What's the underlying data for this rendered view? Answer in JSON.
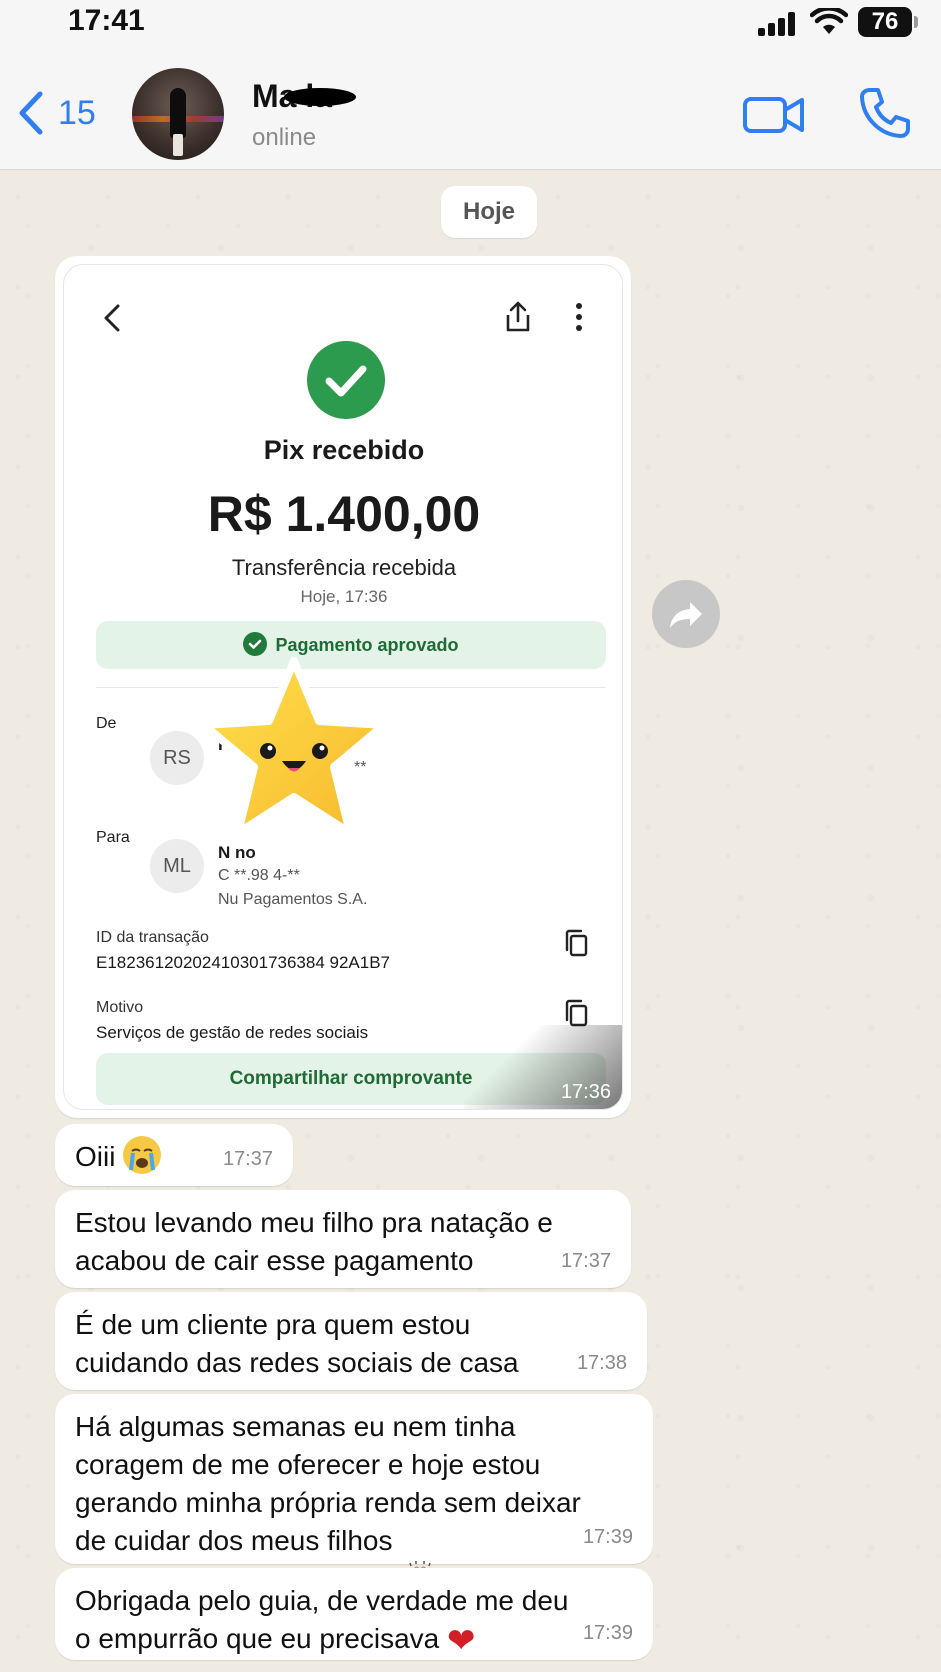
{
  "status_bar": {
    "time": "17:41",
    "battery": "76",
    "signal_icon": "signal-bars-icon",
    "wifi_icon": "wifi-icon"
  },
  "header": {
    "back_count": "15",
    "contact_name": "Ma    la",
    "contact_status": "online",
    "video_icon": "video-camera-icon",
    "call_icon": "phone-icon",
    "accent_color": "#2f7ff2"
  },
  "chat": {
    "date_label": "Hoje",
    "image_message": {
      "time": "17:36",
      "receipt": {
        "title": "Pix recebido",
        "amount": "R$ 1.400,00",
        "subtitle": "Transferência recebida",
        "date": "Hoje, 17:36",
        "status": "Pagamento aprovado",
        "from_label": "De",
        "from_initials": "RS",
        "from_name": "Rod      va",
        "from_line": "**",
        "to_label": "Para",
        "to_initials": "ML",
        "to_name": "N              no",
        "to_line": "C    **.98   4-**",
        "to_bank": "Nu Pagamentos S.A.",
        "transaction_label": "ID da transação",
        "transaction_id": "E18236120202410301736384 92A1B7",
        "reason_label": "Motivo",
        "reason": "Serviços de gestão de redes sociais",
        "share_button": "Compartilhar comprovante",
        "success_color": "#2d9b4e"
      }
    },
    "messages": [
      {
        "text": "Oiii",
        "emoji": "loudly-crying-face-emoji",
        "time": "17:37"
      },
      {
        "text": "Estou levando meu filho pra natação e\nacabou de cair esse pagamento",
        "time": "17:37"
      },
      {
        "text": "É de um cliente pra quem estou\ncuidando das redes sociais de casa",
        "time": "17:38"
      },
      {
        "text": "Há algumas semanas eu nem tinha\ncoragem de me oferecer e hoje estou\ngerando minha própria renda sem deixar\nde cuidar dos meus filhos",
        "emoji": "raising-hands-emoji",
        "time": "17:39"
      },
      {
        "text": "Obrigada pelo guia, de verdade me deu\no empurrão que eu precisava",
        "emoji": "red-heart-emoji",
        "time": "17:39"
      }
    ]
  }
}
